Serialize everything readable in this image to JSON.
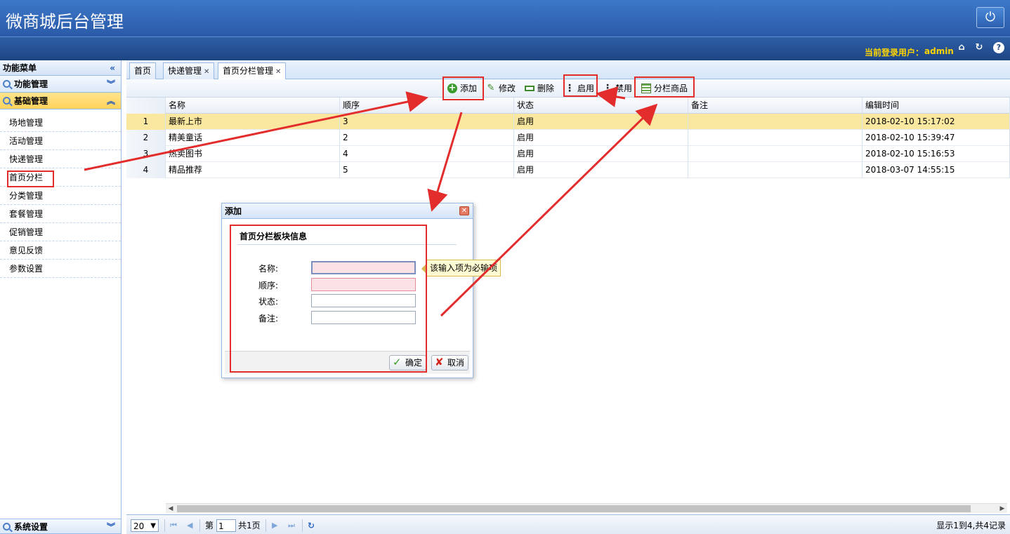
{
  "header": {
    "title": "微商城后台管理",
    "user_label": "当前登录用户：",
    "user_name": "admin",
    "icons": {
      "power": "power-icon",
      "home": "home-icon",
      "refresh": "refresh-icon",
      "help": "help-icon"
    }
  },
  "sidebar": {
    "title": "功能菜单",
    "sections": [
      {
        "label": "功能管理",
        "state": "collapsed"
      },
      {
        "label": "基础管理",
        "state": "expanded"
      }
    ],
    "items": [
      {
        "label": "场地管理"
      },
      {
        "label": "活动管理"
      },
      {
        "label": "快递管理"
      },
      {
        "label": "首页分栏"
      },
      {
        "label": "分类管理"
      },
      {
        "label": "套餐管理"
      },
      {
        "label": "促销管理"
      },
      {
        "label": "意见反馈"
      },
      {
        "label": "参数设置"
      }
    ],
    "bottom_section": {
      "label": "系统设置"
    }
  },
  "tabs": [
    {
      "label": "首页",
      "closable": false
    },
    {
      "label": "快递管理",
      "closable": true
    },
    {
      "label": "首页分栏管理",
      "closable": true,
      "active": true
    }
  ],
  "toolbar": {
    "add": "添加",
    "edit": "修改",
    "delete": "删除",
    "enable": "启用",
    "disable": "禁用",
    "column_goods": "分栏商品"
  },
  "table": {
    "columns": [
      "名称",
      "顺序",
      "状态",
      "备注",
      "编辑时间"
    ],
    "rows": [
      {
        "num": "1",
        "name": "最新上市",
        "order": "3",
        "status": "启用",
        "note": "",
        "time": "2018-02-10 15:17:02"
      },
      {
        "num": "2",
        "name": "精美童话",
        "order": "2",
        "status": "启用",
        "note": "",
        "time": "2018-02-10 15:39:47"
      },
      {
        "num": "3",
        "name": "热卖图书",
        "order": "4",
        "status": "启用",
        "note": "",
        "time": "2018-02-10 15:16:53"
      },
      {
        "num": "4",
        "name": "精品推荐",
        "order": "5",
        "status": "启用",
        "note": "",
        "time": "2018-03-07 14:55:15"
      }
    ],
    "selected_row": 0
  },
  "pager": {
    "page_size": "20",
    "page_prefix": "第",
    "page_value": "1",
    "page_suffix": "共1页",
    "summary": "显示1到4,共4记录"
  },
  "dialog": {
    "title": "添加",
    "section": "首页分栏板块信息",
    "fields": [
      {
        "label": "名称:",
        "value": "",
        "invalid": true,
        "focused": true
      },
      {
        "label": "顺序:",
        "value": "",
        "invalid": true
      },
      {
        "label": "状态:",
        "value": ""
      },
      {
        "label": "备注:",
        "value": ""
      }
    ],
    "tooltip": "该输入项为必输项",
    "ok": "确定",
    "cancel": "取消"
  },
  "colors": {
    "header": "#2a5aa8",
    "selected_row": "#fbe8a0",
    "annotation": "#e32c2c",
    "user_text": "#ffd400"
  }
}
